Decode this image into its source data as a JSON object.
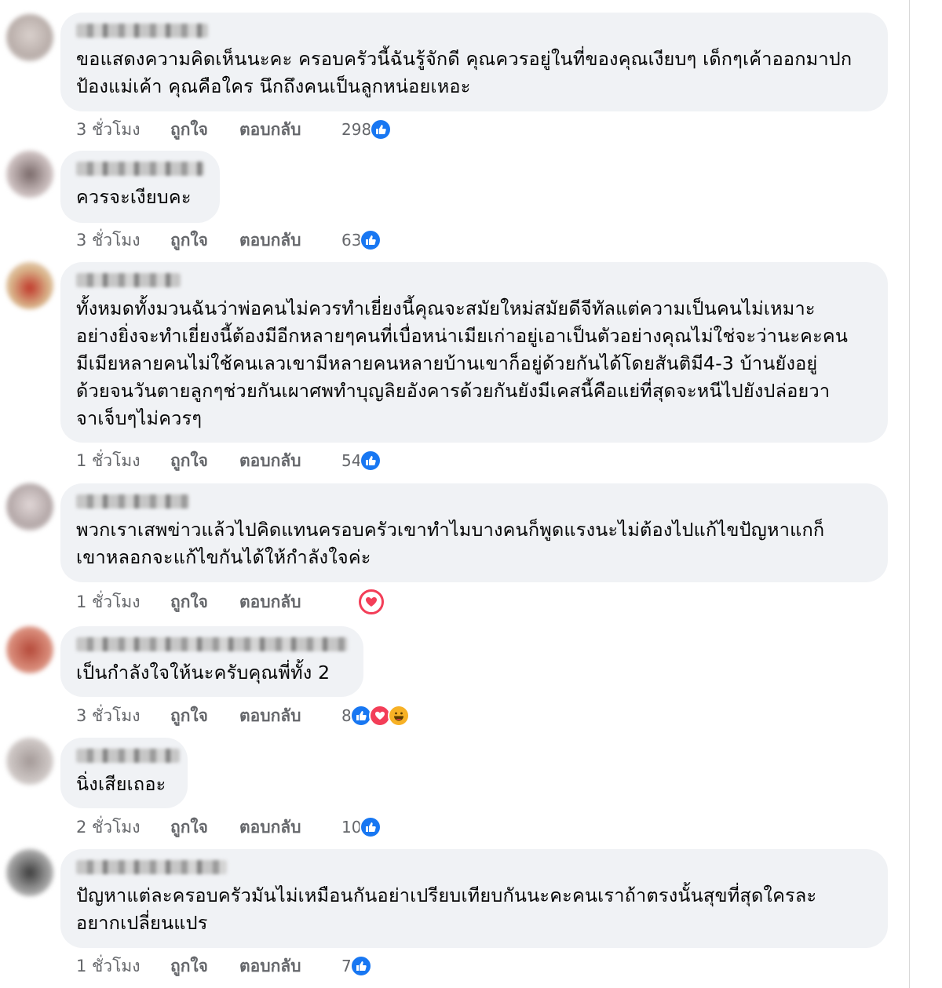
{
  "comments": [
    {
      "text": "ขอแสดงความคิดเห็นนะคะ ครอบครัวนี้ฉันรู้จักดี คุณควรอยู่ในที่ของคุณเงียบๆ เด็กๆเค้าออกมาปก\nป้องแม่เค้า คุณคือใคร นึกถึงคนเป็นลูกหน่อยเหอะ",
      "time": "3 ชั่วโมง",
      "like": "ถูกใจ",
      "reply": "ตอบกลับ",
      "reaction_count": "298",
      "reactions": [
        "like"
      ]
    },
    {
      "text": "ควรจะเงียบคะ",
      "time": "3 ชั่วโมง",
      "like": "ถูกใจ",
      "reply": "ตอบกลับ",
      "reaction_count": "63",
      "reactions": [
        "like"
      ]
    },
    {
      "text": "ทั้งหมดทั้งมวนฉันว่าพ่อคนไม่ควรทำเยี่ยงนี้คุณจะสมัยใหม่สมัยดีจีทัลแต่ความเป็นคนไม่เหมาะ\nอย่างยิ่งจะทำเยี่ยงนี้ต้องมีอีกหลายๆคนที่เบื่อหน่าเมียเก่าอยู่เอาเป็นตัวอย่างคุณไม่ใช่จะว่านะคะคน\nมีเมียหลายคนไม่ใช้คนเลวเขามีหลายคนหลายบ้านเขาก็อยู่ด้วยกันได้โดยสันติมี4-3 บ้านยังอยู่\nด้วยจนวันตายลูกๆช่วยกันเผาศพทำบุญลิยอังคารด้วยกันยังมีเคสนี้คือแย่ที่สุดจะหนีไปยังปล่อยวา\nจาเจ็บๆไม่ควรๆ",
      "time": "1 ชั่วโมง",
      "like": "ถูกใจ",
      "reply": "ตอบกลับ",
      "reaction_count": "54",
      "reactions": [
        "like"
      ]
    },
    {
      "text": "พวกเราเสพข่าวแล้วไปคิดแทนครอบครัวเขาทำไมบางคนก็พูดแรงนะไม่ต้องไปแก้ไขปัญหาแกก็\nเขาหลอกจะแก้ไขกันได้ให้กำลังใจค่ะ",
      "time": "1 ชั่วโมง",
      "like": "ถูกใจ",
      "reply": "ตอบกลับ",
      "reaction_count": "",
      "reactions": [
        "love-outline"
      ]
    },
    {
      "text": "เป็นกำลังใจให้นะครับคุณพี่ทั้ง 2",
      "time": "3 ชั่วโมง",
      "like": "ถูกใจ",
      "reply": "ตอบกลับ",
      "reaction_count": "8",
      "reactions": [
        "like",
        "love",
        "haha"
      ]
    },
    {
      "text": "นิ่งเสียเถอะ",
      "time": "2 ชั่วโมง",
      "like": "ถูกใจ",
      "reply": "ตอบกลับ",
      "reaction_count": "10",
      "reactions": [
        "like"
      ]
    },
    {
      "text": "ปัญหาแต่ละครอบครัวมันไม่เหมือนกันอย่าเปรียบเทียบกันนะคะคนเราถ้าตรงนั้นสุขที่สุดใครละ\nอยากเปลี่ยนแปร",
      "time": "1 ชั่วโมง",
      "like": "ถูกใจ",
      "reply": "ตอบกลับ",
      "reaction_count": "7",
      "reactions": [
        "like"
      ]
    }
  ],
  "colors": {
    "bubble": "#f0f2f5",
    "meta_text": "#65676b",
    "like_blue": "#1877f2",
    "love_red": "#f33e58",
    "haha_yellow": "#f7b125"
  }
}
